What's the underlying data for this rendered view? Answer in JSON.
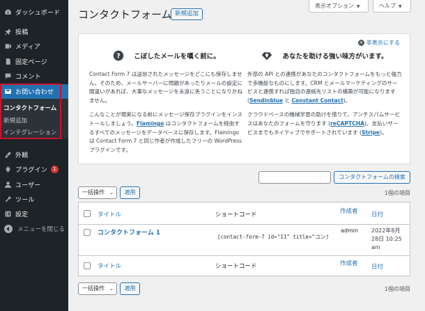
{
  "sidebar": {
    "dashboard": "ダッシュボード",
    "posts": "投稿",
    "media": "メディア",
    "pages": "固定ページ",
    "comments": "コメント",
    "contact": "お問い合わせ",
    "submenu": [
      "コンタクトフォーム",
      "新規追加",
      "インテグレーション"
    ],
    "appearance": "外観",
    "plugins": "プラグイン",
    "plugins_badge": "1",
    "users": "ユーザー",
    "tools": "ツール",
    "settings": "設定",
    "collapse": "メニューを閉じる"
  },
  "header": {
    "title": "コンタクトフォーム",
    "add_new": "新規追加",
    "screen_options": "表示オプション",
    "help": "ヘルプ"
  },
  "welcome": {
    "dismiss": "非表示にする",
    "left": {
      "heading": "こぼしたメールを嘆く前に。",
      "p1": "Contact Form 7 は送信されたメッセージをどこにも保存しません。そのため、メールサーバーに問題があったりメールの設定に間違いがあれば、大事なメッセージを永遠に失うことになりかねません。",
      "p2_a": "こんなことが現実になる前にメッセージ保存プラグインをインストールしましょう。",
      "p2_link": "Flamingo",
      "p2_b": " はコンタクトフォームを経由するすべてのメッセージをデータベースに保存します。Flamingo は Contact Form 7 と同じ作者が作成したフリーの WordPress プラグインです。"
    },
    "right": {
      "heading": "あなたを助ける強い味方がいます。",
      "p1_a": "外部の API との連携があなたのコンタクトフォームをもっと強力で多機能なものにします。CRM とメールマーケティングのサービスと連携すれば独自の連絡先リストの構築が可能になります (",
      "p1_link1": "Sendinblue",
      "p1_mid": " と ",
      "p1_link2": "Constant Contact",
      "p1_b": ")。",
      "p2_a": "クラウドベースの機械学習の助けを借りて、アンチスパムサービスはあなたのフォームを守ります (",
      "p2_link1": "reCAPTCHA",
      "p2_b": ")。支払いサービスまでもネイティブでサポートされています (",
      "p2_link2": "Stripe",
      "p2_c": ")。"
    }
  },
  "search": {
    "button": "コンタクトフォームの検索",
    "value": ""
  },
  "tablenav": {
    "bulk_label": "一括操作",
    "apply": "適用",
    "count": "1個の項目"
  },
  "table": {
    "columns": {
      "title": "タイトル",
      "shortcode": "ショートコード",
      "author": "作成者",
      "date": "日付"
    },
    "rows": [
      {
        "title": "コンタクトフォーム 1",
        "shortcode": "[contact-form-7 id=\"11\" title=\"コンタクトフォーム 1\"]",
        "author": "admin",
        "date_line1": "2022年8月",
        "date_line2": "28日 10:25",
        "date_line3": "am"
      }
    ]
  },
  "colors": {
    "sidebar_bg": "#1d2327",
    "active": "#2271b1",
    "link": "#2271b1",
    "highlight_border": "#d0112b",
    "badge": "#d63638"
  }
}
